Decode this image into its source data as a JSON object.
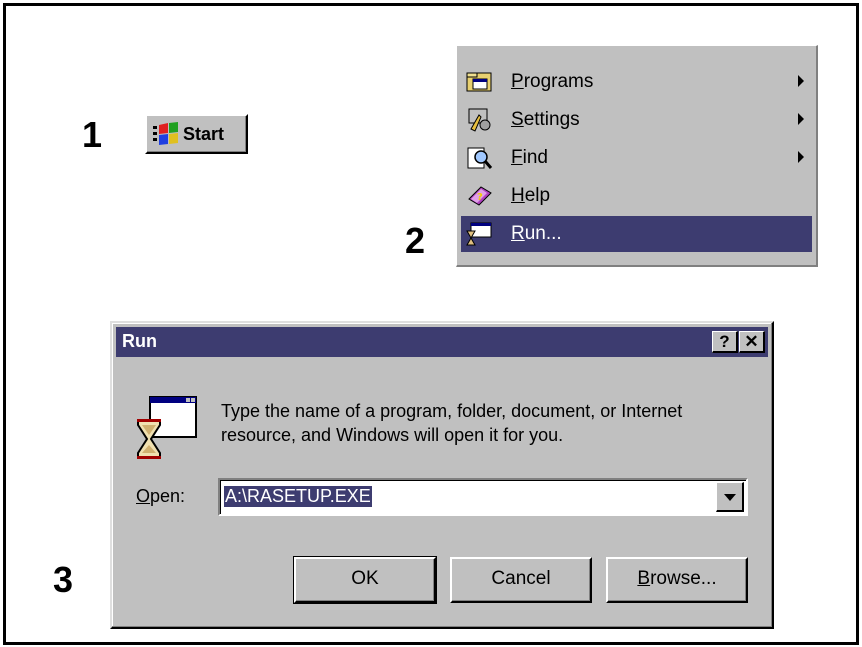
{
  "steps": [
    "1",
    "2",
    "3"
  ],
  "start_button": {
    "label": "Start",
    "icon": "windows-logo-icon"
  },
  "start_menu": {
    "items": [
      {
        "label": "Programs",
        "accel": "P",
        "rest": "rograms",
        "icon": "programs-folder-icon",
        "has_submenu": true
      },
      {
        "label": "Settings",
        "accel": "S",
        "rest": "ettings",
        "icon": "settings-icon",
        "has_submenu": true
      },
      {
        "label": "Find",
        "accel": "F",
        "rest": "ind",
        "icon": "find-magnifier-icon",
        "has_submenu": true
      },
      {
        "label": "Help",
        "accel": "H",
        "rest": "elp",
        "icon": "help-book-icon",
        "has_submenu": false
      },
      {
        "label": "Run...",
        "accel": "R",
        "rest": "un...",
        "icon": "run-icon",
        "has_submenu": false,
        "selected": true
      }
    ]
  },
  "run_dialog": {
    "title": "Run",
    "help_button": "?",
    "close_button": "✕",
    "description_line1": "Type the name of a program, folder, document, or Internet",
    "description_line2": "resource, and Windows will open it for you.",
    "open_label_accel": "O",
    "open_label_rest": "pen:",
    "open_value": "A:\\RASETUP.EXE",
    "buttons": {
      "ok": "OK",
      "cancel": "Cancel",
      "browse_accel": "B",
      "browse_rest": "rowse..."
    }
  },
  "colors": {
    "selection": "#3d3c70",
    "face": "#c0c0c0",
    "titlebar": "#3d3c70"
  }
}
